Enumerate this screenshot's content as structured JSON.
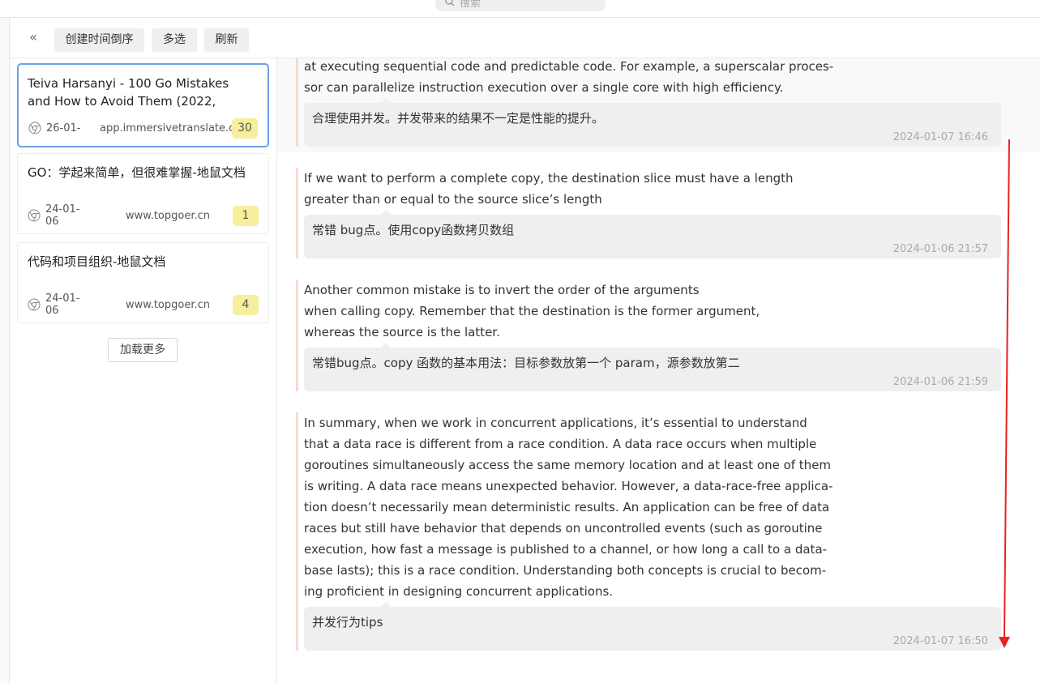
{
  "search": {
    "placeholder": "搜索"
  },
  "toolbar": {
    "collapse": "«",
    "sort_label": "创建时间倒序",
    "multi_select_label": "多选",
    "refresh_label": "刷新"
  },
  "sidebar": {
    "cards": [
      {
        "title": "Teiva Harsanyi - 100 Go Mistakes and How to Avoid Them (2022,",
        "date": "26-01-",
        "site": "app.immersivetranslate.com",
        "count": "30"
      },
      {
        "title": "GO：学起来简单，但很难掌握-地鼠文档",
        "date": "24-01-06",
        "site": "www.topgoer.cn",
        "count": "1"
      },
      {
        "title": "代码和项目组织-地鼠文档",
        "date": "24-01-06",
        "site": "www.topgoer.cn",
        "count": "4"
      }
    ],
    "load_more_label": "加载更多"
  },
  "entries": [
    {
      "text": "at executing sequential code and predictable code. For example, a superscalar proces-\nsor can parallelize instruction execution over a single core with high efficiency.",
      "note": "合理使用并发。并发带来的结果不一定是性能的提升。",
      "time": "2024-01-07 16:46"
    },
    {
      "text": "If we want to perform a complete copy, the destination slice must have a length\ngreater than or equal to the source slice’s length",
      "note": "常错 bug点。使用copy函数拷贝数组",
      "time": "2024-01-06 21:57"
    },
    {
      "text": "Another common mistake is to invert the order of the arguments\nwhen calling copy. Remember that the destination is the former argument,\nwhereas the source is the latter.",
      "note": "常错bug点。copy 函数的基本用法：目标参数放第一个 param，源参数放第二",
      "time": "2024-01-06 21:59"
    },
    {
      "text": "In summary, when we work in concurrent applications, it’s essential to understand\nthat a data race is different from a race condition. A data race occurs when multiple\ngoroutines simultaneously access the same memory location and at least one of them\nis writing. A data race means unexpected behavior. However, a data-race-free applica-\ntion doesn’t necessarily mean deterministic results. An application can be free of data\nraces but still have behavior that depends on uncontrolled events (such as goroutine\nexecution, how fast a message is published to a channel, or how long a call to a data-\nbase lasts); this is a race condition. Understanding both concepts is crucial to becom-\ning proficient in designing concurrent applications.",
      "note": "并发行为tips",
      "time": "2024-01-07 16:50"
    }
  ],
  "colors": {
    "accent_border": "#6aa0e8",
    "badge": "#f7ee9e",
    "quote_bar": "#f8d8cf",
    "annotation_arrow": "#e8231f"
  }
}
